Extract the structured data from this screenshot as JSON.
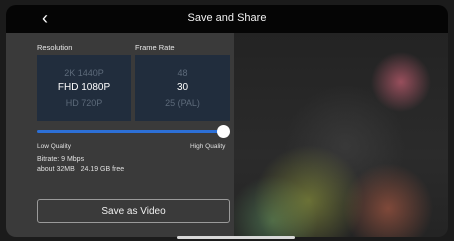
{
  "header": {
    "title": "Save and Share",
    "back_icon": "chevron-left-icon"
  },
  "settings": {
    "resolution_label": "Resolution",
    "frame_rate_label": "Frame Rate",
    "resolution_options": [
      "2K 1440P",
      "FHD 1080P",
      "HD 720P"
    ],
    "resolution_selected": "FHD 1080P",
    "frame_rate_options": [
      "48",
      "30",
      "25 (PAL)"
    ],
    "frame_rate_selected": "30",
    "quality_slider": {
      "low_label": "Low Quality",
      "high_label": "High Quality",
      "value": 1.0
    },
    "bitrate": "Bitrate: 9 Mbps",
    "size_info": "about 32MB   24.19 GB free"
  },
  "actions": {
    "save_label": "Save as Video"
  },
  "colors": {
    "accent": "#2c6fd6",
    "picker_bg": "#212d3d",
    "panel_bg": "#3a3a3a"
  }
}
